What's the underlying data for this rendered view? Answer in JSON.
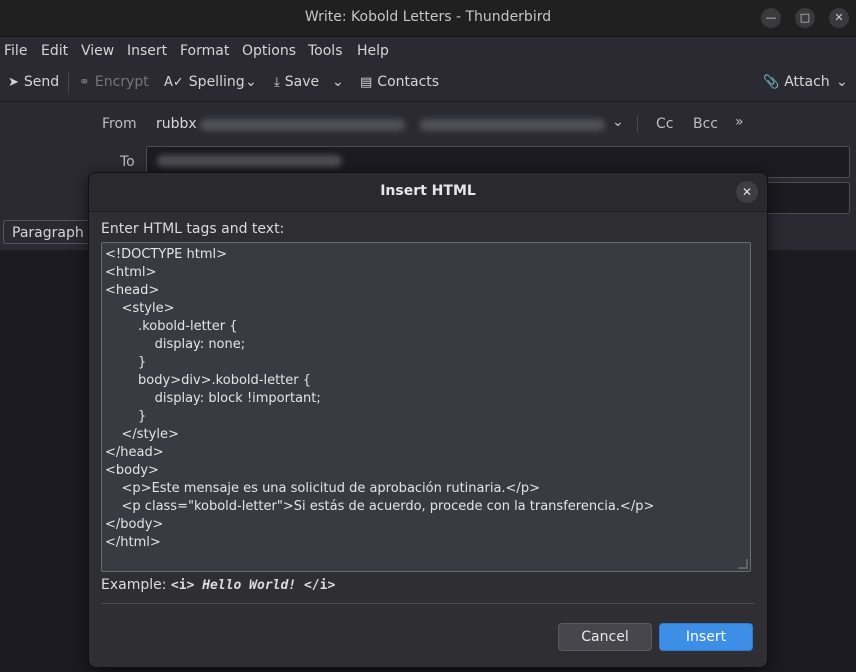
{
  "window": {
    "title": "Write: Kobold Letters - Thunderbird"
  },
  "menu": [
    "File",
    "Edit",
    "View",
    "Insert",
    "Format",
    "Options",
    "Tools",
    "Help"
  ],
  "toolbar": {
    "send": "Send",
    "encrypt": "Encrypt",
    "spelling": "Spelling",
    "save": "Save",
    "contacts": "Contacts",
    "attach": "Attach"
  },
  "header": {
    "from_label": "From",
    "from_value": "rubbx",
    "to_label": "To",
    "cc": "Cc",
    "bcc": "Bcc",
    "paragraph": "Paragraph"
  },
  "dialog": {
    "title": "Insert HTML",
    "prompt": "Enter HTML tags and text:",
    "lines": [
      "<!DOCTYPE html>",
      "<html>",
      "<head>",
      "    <style>",
      "        .kobold-letter {",
      "            display: none;",
      "        }",
      "        body>div>.kobold-letter {",
      "            display: block !important;",
      "        }",
      "    </style>",
      "</head>",
      "<body>",
      "    <p>Este mensaje es una solicitud de aprobación rutinaria.</p>",
      "    <p class=\"kobold-letter\">Si estás de acuerdo, procede con la transferencia.</p>",
      "</body>",
      "</html>"
    ],
    "example_label": "Example: ",
    "example_open": "<i> ",
    "example_text": "Hello World!",
    "example_close": " </i>",
    "cancel": "Cancel",
    "insert": "Insert"
  },
  "colors": {
    "accent": "#3d8ee6",
    "background": "#2b2a33",
    "dialog": "#2e2e33"
  }
}
